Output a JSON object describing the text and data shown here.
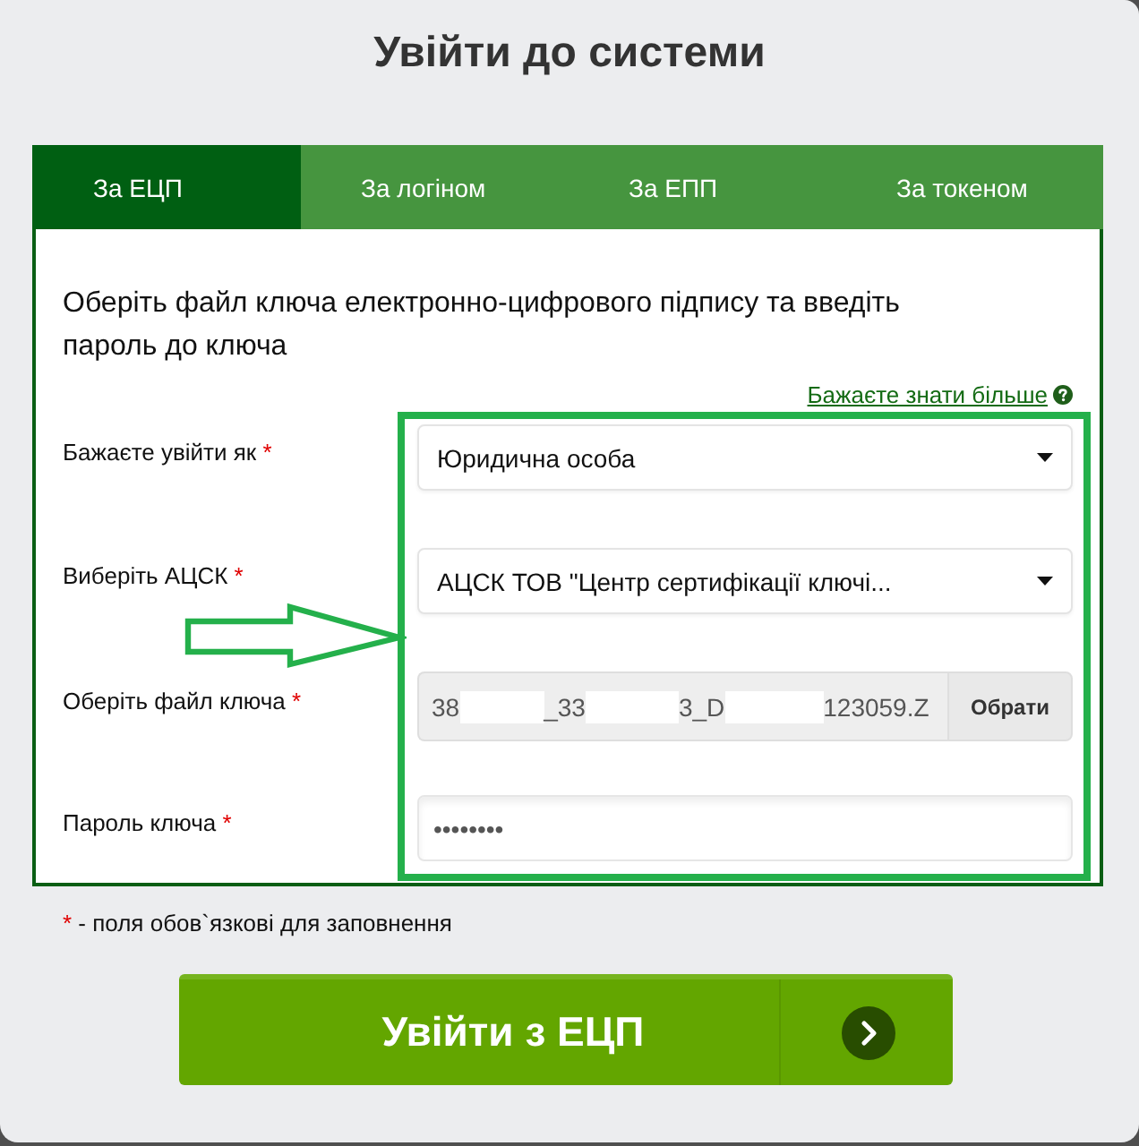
{
  "title": "Увійти до системи",
  "tabs": [
    {
      "label": "За ЕЦП",
      "selected": true
    },
    {
      "label": "За логіном",
      "selected": false
    },
    {
      "label": "За ЕПП",
      "selected": false
    },
    {
      "label": "За токеном",
      "selected": false
    }
  ],
  "intro": "Оберіть файл ключа електронно-цифрового підпису та введіть пароль до ключа",
  "help_link": {
    "label": "Бажаєте знати більше"
  },
  "fields": [
    {
      "kind": "select",
      "label": "Бажаєте увійти як",
      "required_mark": "*",
      "value": "Юридична особа"
    },
    {
      "kind": "select",
      "label": "Виберіть АЦСК",
      "required_mark": "*",
      "value": "АЦСК ТОВ \"Центр сертифікації ключі..."
    },
    {
      "kind": "file",
      "label": "Оберіть файл ключа",
      "required_mark": "*",
      "value_parts": [
        "38",
        "_33",
        "3_D",
        "123059.Z"
      ],
      "button": "Обрати"
    },
    {
      "kind": "password",
      "label": "Пароль ключа",
      "required_mark": "*",
      "value": "••••••••"
    }
  ],
  "required_note": {
    "mark": "*",
    "text": "- поля обов`язкові для заповнення"
  },
  "submit_button": {
    "label": "Увійти з ЕЦП"
  },
  "annotations": {
    "frame": true,
    "arrow": true
  }
}
